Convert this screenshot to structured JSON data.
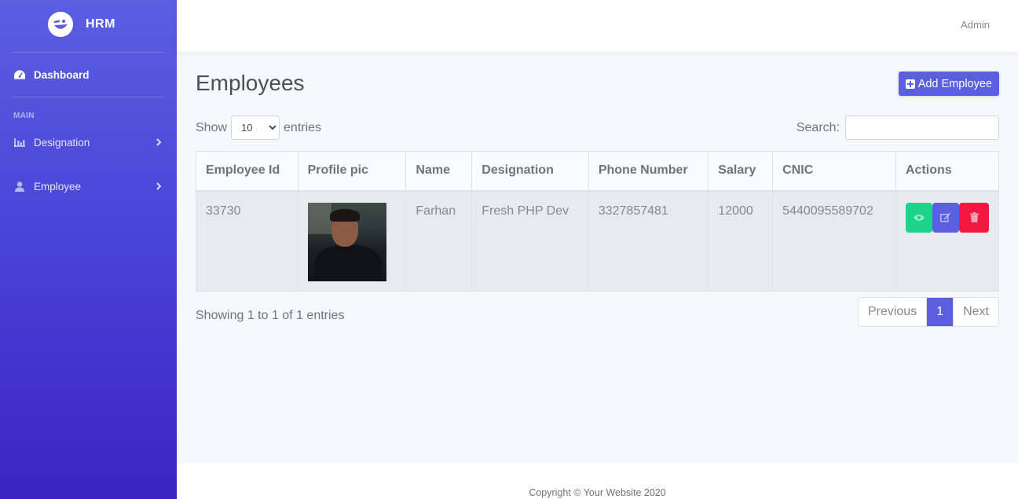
{
  "brand": {
    "name": "HRM"
  },
  "sidebar": {
    "dashboard": "Dashboard",
    "section": "MAIN",
    "items": [
      {
        "label": "Designation",
        "icon": "chart-bar-icon"
      },
      {
        "label": "Employee",
        "icon": "user-icon"
      }
    ]
  },
  "topbar": {
    "user": "Admin"
  },
  "page": {
    "title": "Employees",
    "add_label": "Add Employee"
  },
  "table_controls": {
    "show_label": "Show",
    "entries_label": "entries",
    "length_value": "10",
    "search_label": "Search:"
  },
  "table": {
    "headers": [
      "Employee Id",
      "Profile pic",
      "Name",
      "Designation",
      "Phone Number",
      "Salary",
      "CNIC",
      "Actions"
    ],
    "rows": [
      {
        "id": "33730",
        "name": "Farhan",
        "designation": "Fresh PHP Dev",
        "phone": "3327857481",
        "salary": "12000",
        "cnic": "5440095589702"
      }
    ]
  },
  "pagination": {
    "info": "Showing 1 to 1 of 1 entries",
    "previous": "Previous",
    "current": "1",
    "next": "Next"
  },
  "footer": {
    "text": "Copyright © Your Website 2020"
  },
  "colors": {
    "accent": "#5a5fe0",
    "view": "#1dd38b",
    "delete": "#f2183f"
  }
}
